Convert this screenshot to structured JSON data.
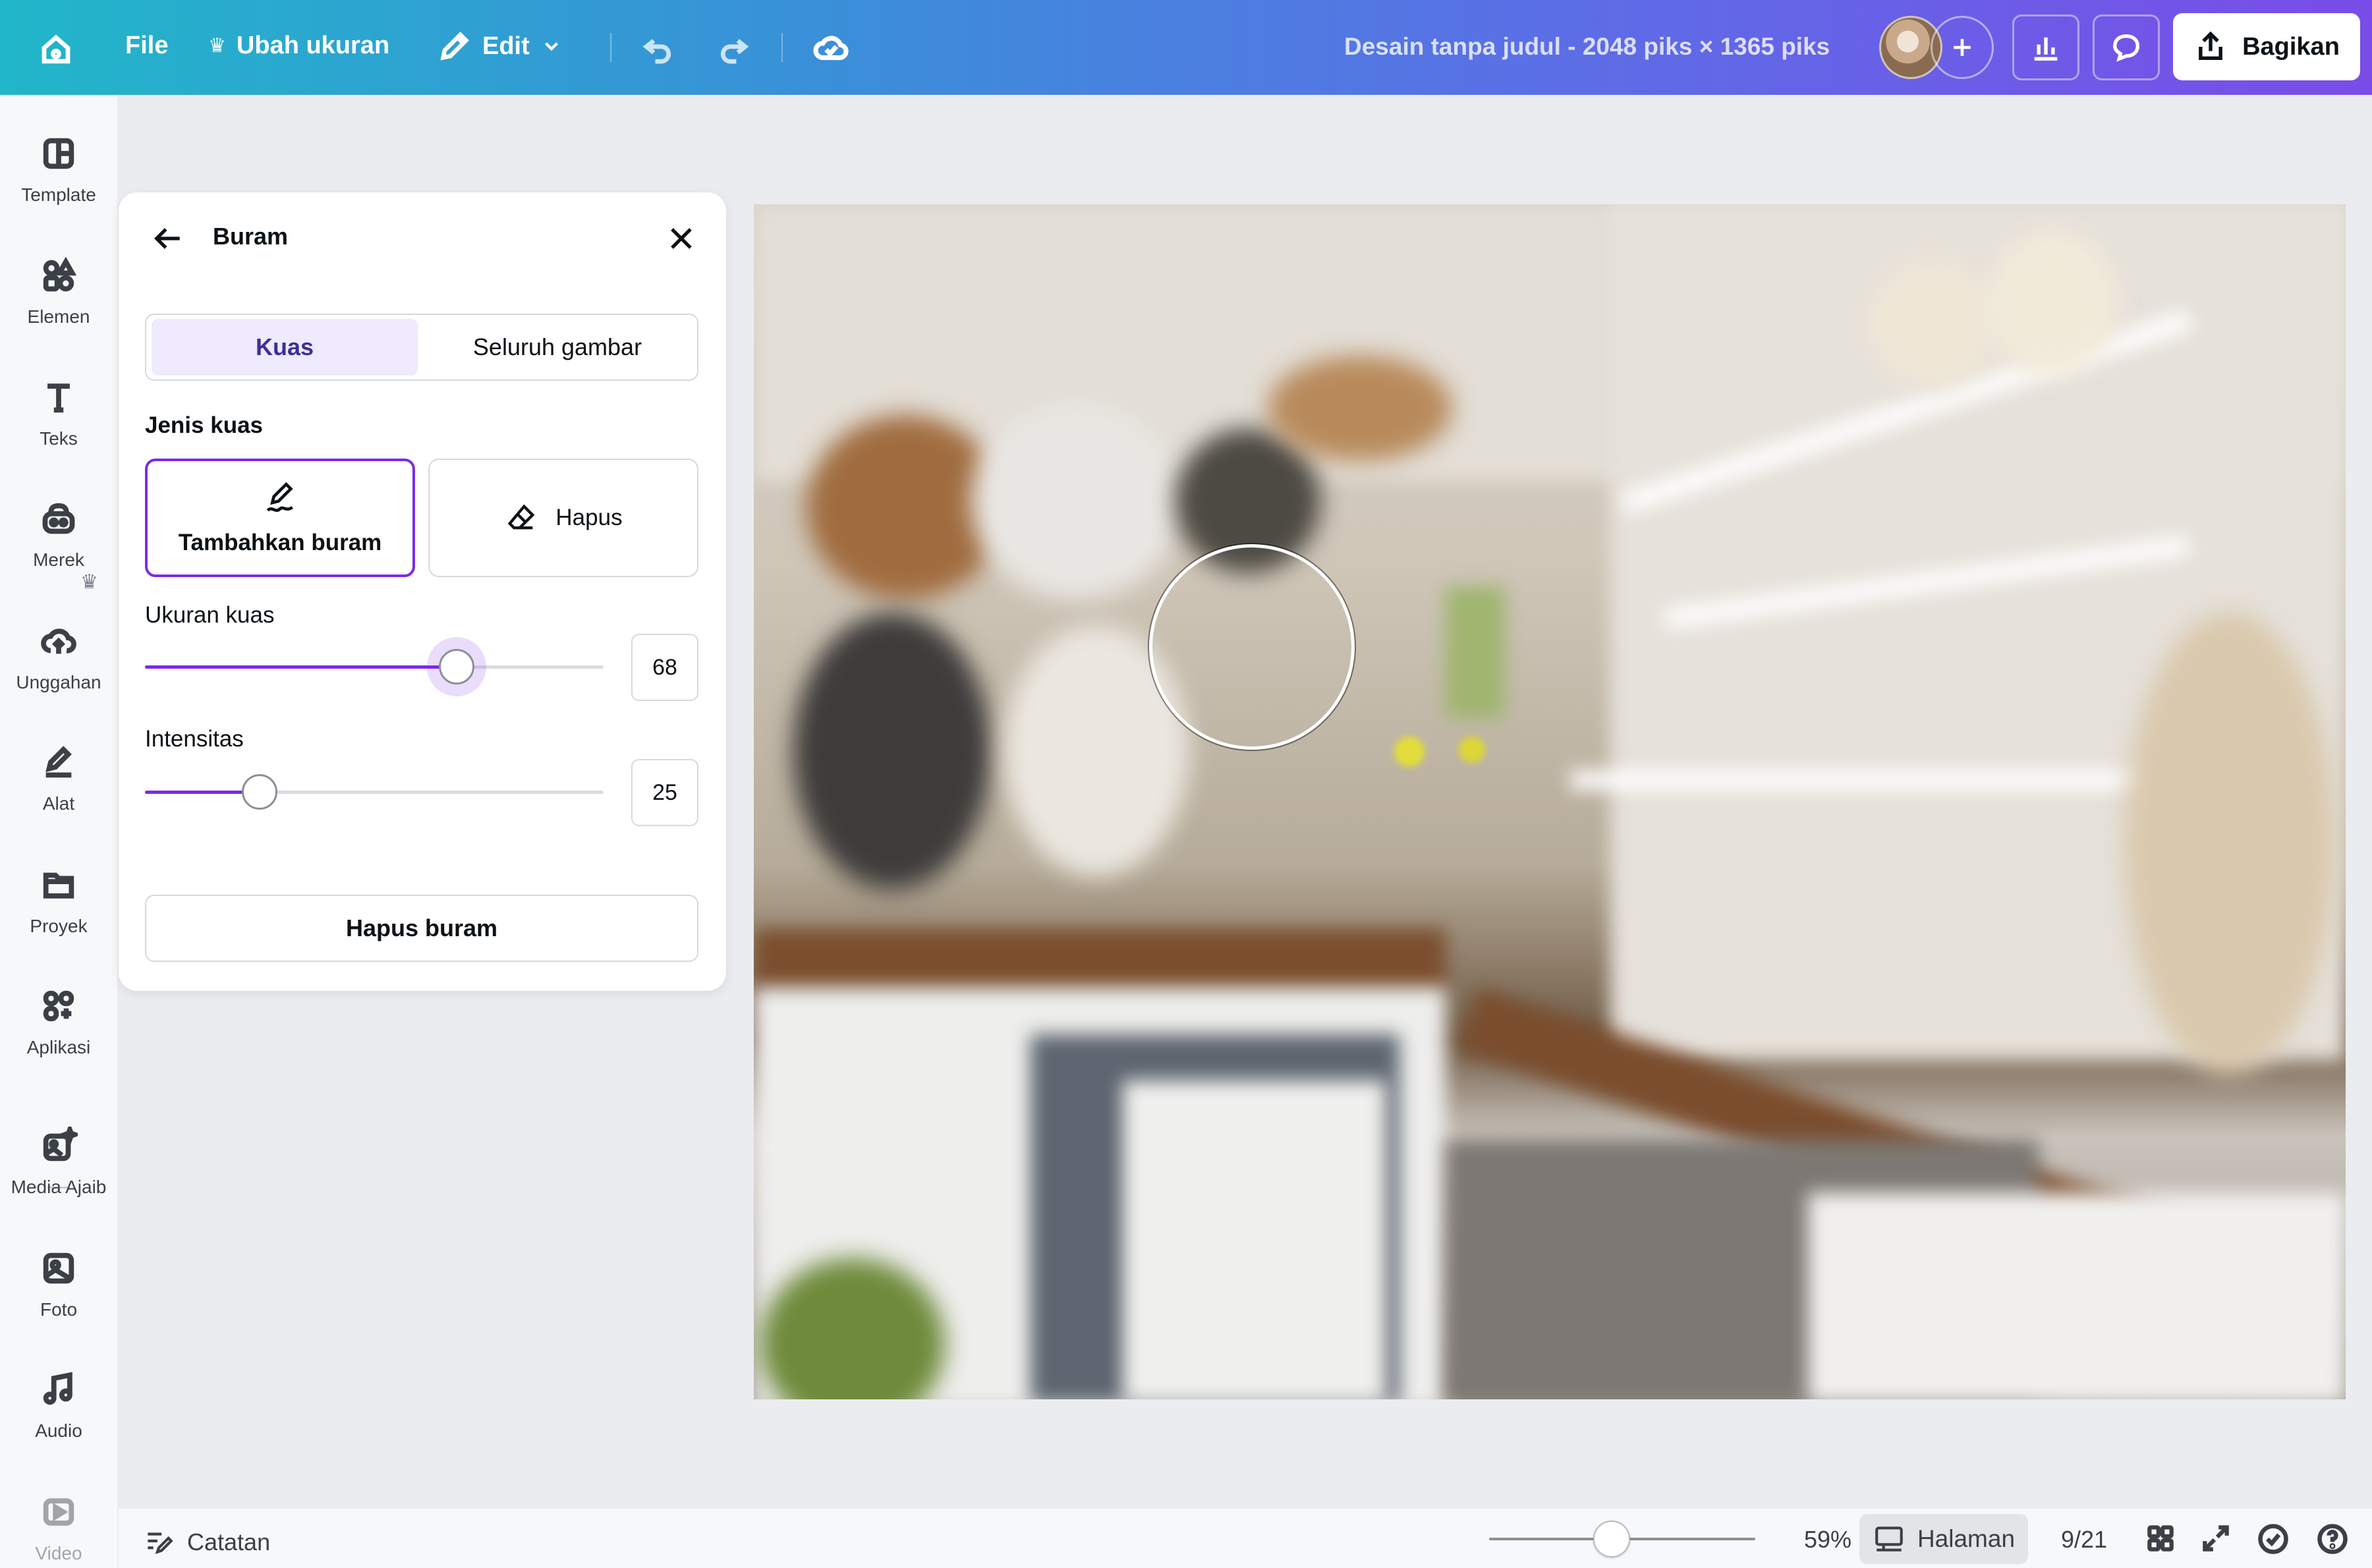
{
  "topbar": {
    "file_label": "File",
    "resize_label": "Ubah ukuran",
    "edit_label": "Edit",
    "doc_title": "Desain tanpa judul - 2048 piks × 1365 piks",
    "share_label": "Bagikan"
  },
  "sidebar": {
    "items": [
      {
        "label": "Template",
        "icon": "template-icon"
      },
      {
        "label": "Elemen",
        "icon": "elements-icon"
      },
      {
        "label": "Teks",
        "icon": "text-icon"
      },
      {
        "label": "Merek",
        "icon": "brand-icon"
      },
      {
        "label": "Unggahan",
        "icon": "upload-icon"
      },
      {
        "label": "Alat",
        "icon": "draw-icon"
      },
      {
        "label": "Proyek",
        "icon": "folder-icon"
      },
      {
        "label": "Aplikasi",
        "icon": "apps-icon"
      },
      {
        "label": "Media Ajaib",
        "icon": "magic-media-icon"
      },
      {
        "label": "Foto",
        "icon": "photo-icon"
      },
      {
        "label": "Audio",
        "icon": "audio-icon"
      },
      {
        "label": "Video",
        "icon": "video-icon"
      }
    ]
  },
  "panel": {
    "title": "Buram",
    "tabs": [
      "Kuas",
      "Seluruh gambar"
    ],
    "active_tab": "Kuas",
    "brush_type_label": "Jenis kuas",
    "brush_add_label": "Tambahkan buram",
    "brush_erase_label": "Hapus",
    "brush_size_label": "Ukuran kuas",
    "brush_size_value": "68",
    "brush_size_fraction": 0.68,
    "intensity_label": "Intensitas",
    "intensity_value": "25",
    "intensity_fraction": 0.25,
    "clear_blur_label": "Hapus buram"
  },
  "bottombar": {
    "notes_label": "Catatan",
    "zoom_value": "59%",
    "pages_label": "Halaman",
    "page_count": "9/21"
  },
  "colors": {
    "accent": "#7d2ae8",
    "accent_tint": "#efeafd"
  }
}
